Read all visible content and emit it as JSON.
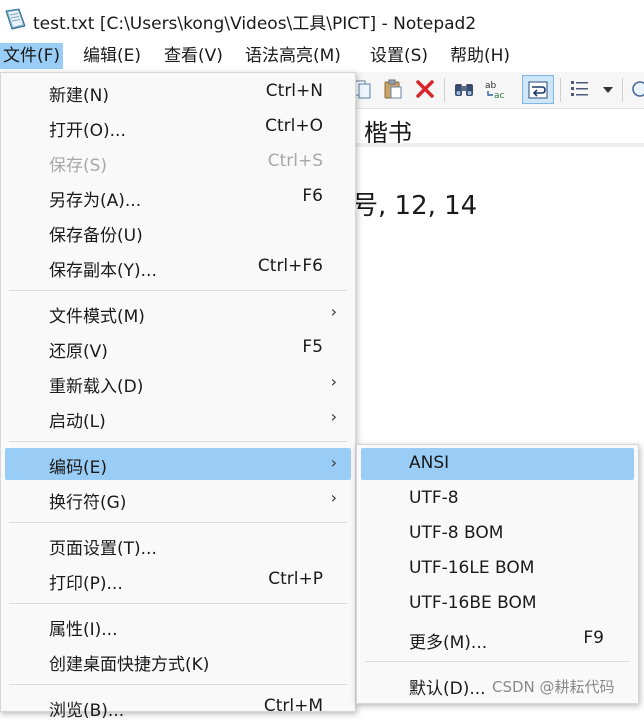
{
  "window": {
    "title": "test.txt [C:\\Users\\kong\\Videos\\工具\\PICT] - Notepad2",
    "icon": "notepad-icon"
  },
  "menubar": {
    "items": [
      {
        "label": "文件(F)",
        "active": true
      },
      {
        "label": "编辑(E)"
      },
      {
        "label": "查看(V)"
      },
      {
        "label": "语法高亮(M)"
      },
      {
        "label": "设置(S)"
      },
      {
        "label": "帮助(H)"
      }
    ]
  },
  "toolbar": {
    "icons": [
      "copy-icon",
      "paste-icon",
      "delete-icon",
      "find-icon",
      "replace-icon",
      "word-wrap-icon",
      "list-icon",
      "dropdown-arrow-icon",
      "zoom-icon"
    ]
  },
  "editor": {
    "line1": "楷书",
    "line2": "号, 12, 14"
  },
  "file_menu": {
    "items": [
      {
        "label": "新建(N)",
        "shortcut": "Ctrl+N"
      },
      {
        "label": "打开(O)...",
        "shortcut": "Ctrl+O"
      },
      {
        "label": "保存(S)",
        "shortcut": "Ctrl+S",
        "disabled": true
      },
      {
        "label": "另存为(A)...",
        "shortcut": "F6"
      },
      {
        "label": "保存备份(U)",
        "shortcut": ""
      },
      {
        "label": "保存副本(Y)...",
        "shortcut": "Ctrl+F6"
      },
      {
        "label": "文件模式(M)",
        "submenu": true
      },
      {
        "label": "还原(V)",
        "shortcut": "F5"
      },
      {
        "label": "重新载入(D)",
        "submenu": true
      },
      {
        "label": "启动(L)",
        "submenu": true
      },
      {
        "label": "编码(E)",
        "submenu": true,
        "highlighted": true
      },
      {
        "label": "换行符(G)",
        "submenu": true
      },
      {
        "label": "页面设置(T)...",
        "shortcut": ""
      },
      {
        "label": "打印(P)...",
        "shortcut": "Ctrl+P"
      },
      {
        "label": "属性(I)...",
        "shortcut": ""
      },
      {
        "label": "创建桌面快捷方式(K)",
        "shortcut": ""
      },
      {
        "label": "浏览(B)...",
        "shortcut": "Ctrl+M"
      }
    ]
  },
  "encoding_menu": {
    "items": [
      {
        "label": "ANSI",
        "highlighted": true
      },
      {
        "label": "UTF-8"
      },
      {
        "label": "UTF-8 BOM"
      },
      {
        "label": "UTF-16LE BOM"
      },
      {
        "label": "UTF-16BE BOM"
      },
      {
        "label": "更多(M)...",
        "shortcut": "F9"
      },
      {
        "label": "默认(D)..."
      }
    ]
  },
  "watermark": "CSDN @耕耘代码",
  "colors": {
    "highlight": "#99cdf5",
    "menu_bg": "#f9f9f9",
    "disabled_text": "#a8a8a8",
    "delete_icon": "#d8262c"
  }
}
